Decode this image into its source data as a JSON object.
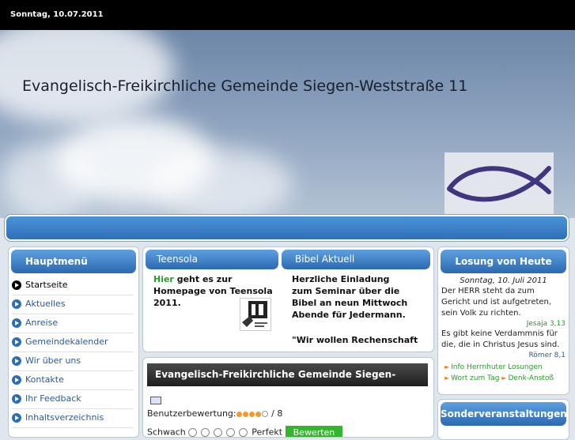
{
  "topbar": {
    "date": "Sonntag, 10.07.2011"
  },
  "header": {
    "title": "Evangelisch-Freikirchliche Gemeinde Siegen-Weststraße 11"
  },
  "sidebar": {
    "title": "Hauptmenü",
    "items": [
      {
        "label": "Startseite"
      },
      {
        "label": "Aktuelles"
      },
      {
        "label": "Anreise"
      },
      {
        "label": "Gemeindekalender"
      },
      {
        "label": "Wir über uns"
      },
      {
        "label": "Kontakte"
      },
      {
        "label": "Ihr Feedback"
      },
      {
        "label": "Inhaltsverzeichnis"
      }
    ]
  },
  "tabs": {
    "teensola": {
      "label": "Teensola",
      "link": "Hier",
      "text": " geht es zur Homepage von Teensola 2011."
    },
    "bibel": {
      "label": "Bibel Aktuell",
      "text": "Herzliche Einladung zum Seminar über die Bibel an neun Mittwoch Abende für Jedermann.",
      "quote": "\"Wir wollen Rechenschaft"
    }
  },
  "article": {
    "title": "Evangelisch-Freikirchliche Gemeinde Siegen-",
    "rating_label": "Benutzerbewertung:",
    "rating_value": 4,
    "rating_max": 5,
    "rating_votes": "/ 8",
    "vote_poor": "Schwach",
    "vote_best": "Perfekt",
    "vote_button": "Bewerten"
  },
  "losung": {
    "title": "Losung von Heute",
    "date": "Sonntag, 10. Juli 2011",
    "verse1": "Der HERR steht da zum Gericht und ist aufgetreten, sein Volk zu richten.",
    "ref1": "Jesaja 3,13",
    "verse2": "Es gibt keine Verdammnis für die, die in Christus Jesus sind.",
    "ref2": "Römer 8,1",
    "link1": "Info Herrnhuter Losungen",
    "link2": "Wort zum Tag",
    "link3": "Denk-Anstoß"
  },
  "sonder": {
    "title": "Sonderveranstaltungen"
  },
  "colors": {
    "accent": "#2c69b1",
    "link_green": "#2a9a2a",
    "header_dark": "#1f1f1f"
  }
}
